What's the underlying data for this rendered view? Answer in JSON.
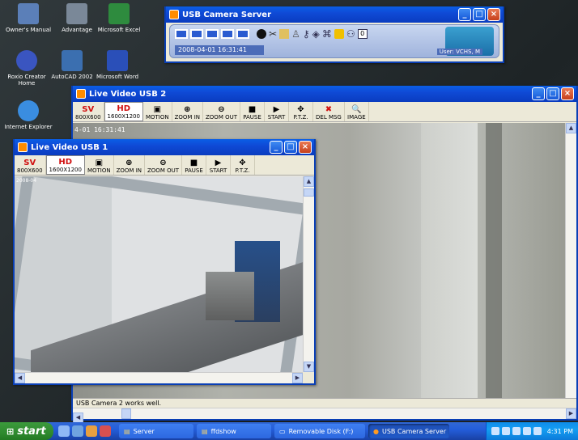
{
  "desktop": {
    "icons": [
      "Owner's Manual",
      "Advantage",
      "Microsoft Excel",
      "Roxio Creator Home",
      "AutoCAD 2002",
      "Microsoft Word",
      "Internet Explorer"
    ]
  },
  "server_window": {
    "title": "USB Camera Server",
    "datetime": "2008-04-01  16:31:41",
    "user": "User: VCHS, M",
    "counter": "0"
  },
  "video2_window": {
    "title": "Live Video USB 2",
    "toolbar": [
      {
        "top": "SV",
        "label": "800X600",
        "icon": "sv-icon"
      },
      {
        "top": "HD",
        "label": "1600X1200",
        "icon": "hd-icon"
      },
      {
        "top": "▣",
        "label": "MOTION",
        "icon": "motion-icon"
      },
      {
        "top": "⊕",
        "label": "ZOOM IN",
        "icon": "zoom-in-icon"
      },
      {
        "top": "⊖",
        "label": "ZOOM OUT",
        "icon": "zoom-out-icon"
      },
      {
        "top": "■",
        "label": "PAUSE",
        "icon": "pause-icon"
      },
      {
        "top": "▶",
        "label": "START",
        "icon": "start-icon"
      },
      {
        "top": "✥",
        "label": "P.T.Z.",
        "icon": "ptz-icon"
      },
      {
        "top": "✖",
        "label": "DEL MSG",
        "icon": "delete-message-icon"
      },
      {
        "top": "🔍",
        "label": "IMAGE",
        "icon": "image-search-icon"
      }
    ],
    "timestamp": "4-01 16:31:41",
    "status": "USB Camera 2 works well."
  },
  "video1_window": {
    "title": "Live Video USB 1",
    "toolbar": [
      {
        "top": "SV",
        "label": "800X600",
        "icon": "sv-icon"
      },
      {
        "top": "HD",
        "label": "1600X1200",
        "icon": "hd-icon"
      },
      {
        "top": "▣",
        "label": "MOTION",
        "icon": "motion-icon"
      },
      {
        "top": "⊕",
        "label": "ZOOM IN",
        "icon": "zoom-in-icon"
      },
      {
        "top": "⊖",
        "label": "ZOOM OUT",
        "icon": "zoom-out-icon"
      },
      {
        "top": "■",
        "label": "PAUSE",
        "icon": "pause-icon"
      },
      {
        "top": "▶",
        "label": "START",
        "icon": "start-icon"
      },
      {
        "top": "✥",
        "label": "P.T.Z.",
        "icon": "ptz-icon"
      }
    ],
    "timestamp": "2008-04"
  },
  "taskbar": {
    "start_label": "start",
    "buttons": [
      "Server",
      "ffdshow",
      "Removable Disk (F:)",
      "USB Camera Server"
    ],
    "clock": "4:31 PM"
  },
  "colors": {
    "title_blue": "#0a4ad6",
    "start_green": "#2f8a2f",
    "hd_red": "#d01010"
  }
}
